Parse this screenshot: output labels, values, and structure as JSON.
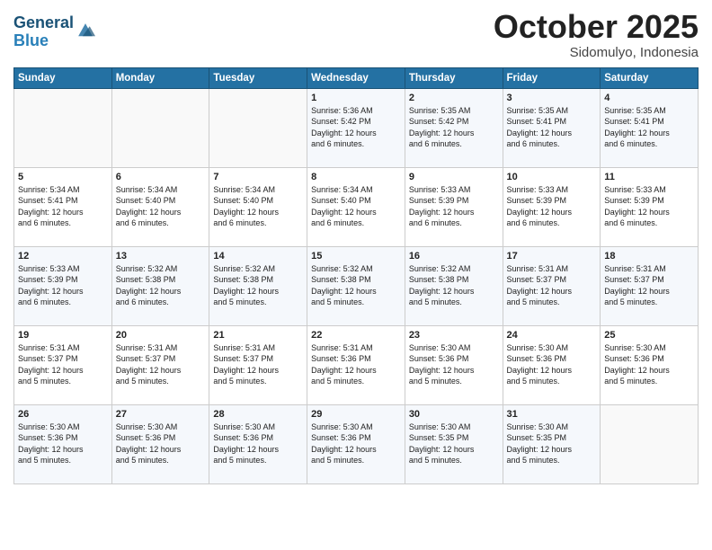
{
  "header": {
    "logo_line1": "General",
    "logo_line2": "Blue",
    "month": "October 2025",
    "location": "Sidomulyo, Indonesia"
  },
  "weekdays": [
    "Sunday",
    "Monday",
    "Tuesday",
    "Wednesday",
    "Thursday",
    "Friday",
    "Saturday"
  ],
  "weeks": [
    [
      {
        "day": "",
        "info": ""
      },
      {
        "day": "",
        "info": ""
      },
      {
        "day": "",
        "info": ""
      },
      {
        "day": "1",
        "info": "Sunrise: 5:36 AM\nSunset: 5:42 PM\nDaylight: 12 hours\nand 6 minutes."
      },
      {
        "day": "2",
        "info": "Sunrise: 5:35 AM\nSunset: 5:42 PM\nDaylight: 12 hours\nand 6 minutes."
      },
      {
        "day": "3",
        "info": "Sunrise: 5:35 AM\nSunset: 5:41 PM\nDaylight: 12 hours\nand 6 minutes."
      },
      {
        "day": "4",
        "info": "Sunrise: 5:35 AM\nSunset: 5:41 PM\nDaylight: 12 hours\nand 6 minutes."
      }
    ],
    [
      {
        "day": "5",
        "info": "Sunrise: 5:34 AM\nSunset: 5:41 PM\nDaylight: 12 hours\nand 6 minutes."
      },
      {
        "day": "6",
        "info": "Sunrise: 5:34 AM\nSunset: 5:40 PM\nDaylight: 12 hours\nand 6 minutes."
      },
      {
        "day": "7",
        "info": "Sunrise: 5:34 AM\nSunset: 5:40 PM\nDaylight: 12 hours\nand 6 minutes."
      },
      {
        "day": "8",
        "info": "Sunrise: 5:34 AM\nSunset: 5:40 PM\nDaylight: 12 hours\nand 6 minutes."
      },
      {
        "day": "9",
        "info": "Sunrise: 5:33 AM\nSunset: 5:39 PM\nDaylight: 12 hours\nand 6 minutes."
      },
      {
        "day": "10",
        "info": "Sunrise: 5:33 AM\nSunset: 5:39 PM\nDaylight: 12 hours\nand 6 minutes."
      },
      {
        "day": "11",
        "info": "Sunrise: 5:33 AM\nSunset: 5:39 PM\nDaylight: 12 hours\nand 6 minutes."
      }
    ],
    [
      {
        "day": "12",
        "info": "Sunrise: 5:33 AM\nSunset: 5:39 PM\nDaylight: 12 hours\nand 6 minutes."
      },
      {
        "day": "13",
        "info": "Sunrise: 5:32 AM\nSunset: 5:38 PM\nDaylight: 12 hours\nand 6 minutes."
      },
      {
        "day": "14",
        "info": "Sunrise: 5:32 AM\nSunset: 5:38 PM\nDaylight: 12 hours\nand 5 minutes."
      },
      {
        "day": "15",
        "info": "Sunrise: 5:32 AM\nSunset: 5:38 PM\nDaylight: 12 hours\nand 5 minutes."
      },
      {
        "day": "16",
        "info": "Sunrise: 5:32 AM\nSunset: 5:38 PM\nDaylight: 12 hours\nand 5 minutes."
      },
      {
        "day": "17",
        "info": "Sunrise: 5:31 AM\nSunset: 5:37 PM\nDaylight: 12 hours\nand 5 minutes."
      },
      {
        "day": "18",
        "info": "Sunrise: 5:31 AM\nSunset: 5:37 PM\nDaylight: 12 hours\nand 5 minutes."
      }
    ],
    [
      {
        "day": "19",
        "info": "Sunrise: 5:31 AM\nSunset: 5:37 PM\nDaylight: 12 hours\nand 5 minutes."
      },
      {
        "day": "20",
        "info": "Sunrise: 5:31 AM\nSunset: 5:37 PM\nDaylight: 12 hours\nand 5 minutes."
      },
      {
        "day": "21",
        "info": "Sunrise: 5:31 AM\nSunset: 5:37 PM\nDaylight: 12 hours\nand 5 minutes."
      },
      {
        "day": "22",
        "info": "Sunrise: 5:31 AM\nSunset: 5:36 PM\nDaylight: 12 hours\nand 5 minutes."
      },
      {
        "day": "23",
        "info": "Sunrise: 5:30 AM\nSunset: 5:36 PM\nDaylight: 12 hours\nand 5 minutes."
      },
      {
        "day": "24",
        "info": "Sunrise: 5:30 AM\nSunset: 5:36 PM\nDaylight: 12 hours\nand 5 minutes."
      },
      {
        "day": "25",
        "info": "Sunrise: 5:30 AM\nSunset: 5:36 PM\nDaylight: 12 hours\nand 5 minutes."
      }
    ],
    [
      {
        "day": "26",
        "info": "Sunrise: 5:30 AM\nSunset: 5:36 PM\nDaylight: 12 hours\nand 5 minutes."
      },
      {
        "day": "27",
        "info": "Sunrise: 5:30 AM\nSunset: 5:36 PM\nDaylight: 12 hours\nand 5 minutes."
      },
      {
        "day": "28",
        "info": "Sunrise: 5:30 AM\nSunset: 5:36 PM\nDaylight: 12 hours\nand 5 minutes."
      },
      {
        "day": "29",
        "info": "Sunrise: 5:30 AM\nSunset: 5:36 PM\nDaylight: 12 hours\nand 5 minutes."
      },
      {
        "day": "30",
        "info": "Sunrise: 5:30 AM\nSunset: 5:35 PM\nDaylight: 12 hours\nand 5 minutes."
      },
      {
        "day": "31",
        "info": "Sunrise: 5:30 AM\nSunset: 5:35 PM\nDaylight: 12 hours\nand 5 minutes."
      },
      {
        "day": "",
        "info": ""
      }
    ]
  ]
}
